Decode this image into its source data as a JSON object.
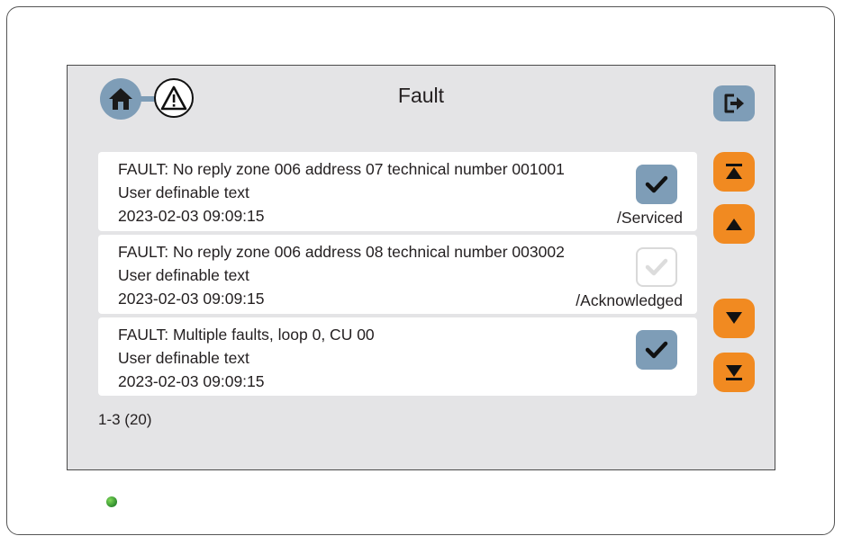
{
  "header": {
    "title": "Fault",
    "home_icon": "home-icon",
    "fault_icon": "warning-triangle-icon",
    "logout_icon": "logout-icon"
  },
  "faults": [
    {
      "message": "FAULT: No reply zone 006 address 07 technical number 001001",
      "user_text": "User definable text",
      "timestamp": "2023-02-03 09:09:15",
      "status": "/Serviced",
      "checked": true
    },
    {
      "message": "FAULT: No reply zone 006 address 08 technical number 003002",
      "user_text": "User definable text",
      "timestamp": "2023-02-03 09:09:15",
      "status": "/Acknowledged",
      "checked": false
    },
    {
      "message": "FAULT: Multiple faults, loop 0, CU 00",
      "user_text": "User definable text",
      "timestamp": "2023-02-03 09:09:15",
      "status": "",
      "checked": true
    }
  ],
  "pager": {
    "text": "1-3 (20)"
  },
  "scroll": {
    "top_icon": "scroll-top-icon",
    "up_icon": "scroll-up-icon",
    "down_icon": "scroll-down-icon",
    "bottom_icon": "scroll-bottom-icon"
  },
  "colors": {
    "accent_blue": "#7e9db7",
    "accent_orange": "#f18a21",
    "screen_bg": "#e4e4e6",
    "led_green": "#2e8b2e"
  }
}
